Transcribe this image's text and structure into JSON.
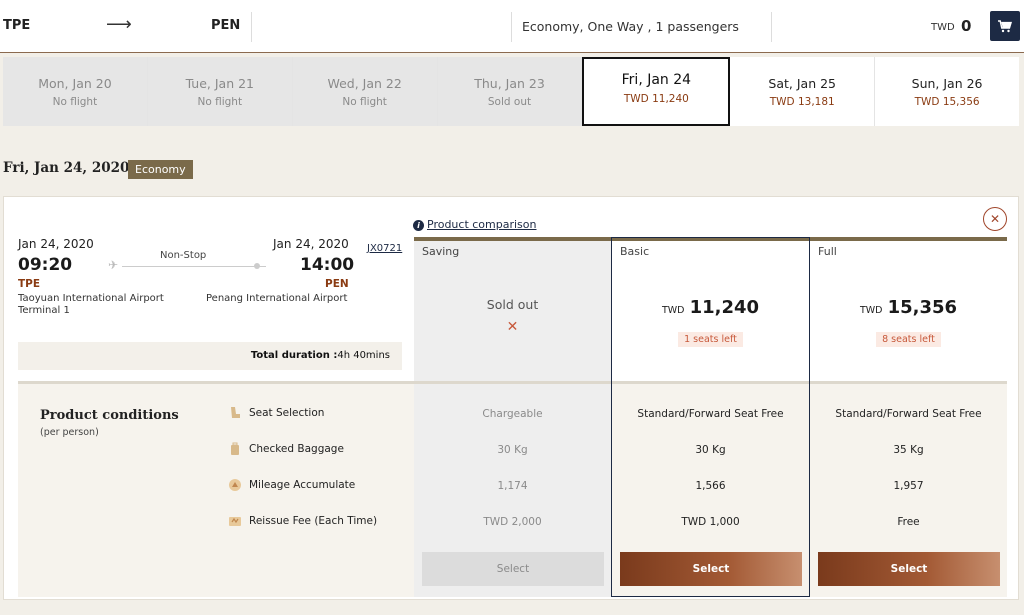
{
  "search": {
    "origin": "TPE",
    "destination": "PEN",
    "trip_summary": "Economy, One Way , 1 passengers",
    "currency": "TWD",
    "total": "0"
  },
  "dates": [
    {
      "name": "Mon, Jan 20",
      "sub": "No flight",
      "state": "disabled"
    },
    {
      "name": "Tue, Jan 21",
      "sub": "No flight",
      "state": "disabled"
    },
    {
      "name": "Wed, Jan 22",
      "sub": "No flight",
      "state": "disabled"
    },
    {
      "name": "Thu, Jan 23",
      "sub": "Sold out",
      "state": "disabled"
    },
    {
      "name": "Fri, Jan 24",
      "sub": "TWD 11,240",
      "state": "selected"
    },
    {
      "name": "Sat, Jan 25",
      "sub": "TWD 13,181",
      "state": "available"
    },
    {
      "name": "Sun, Jan 26",
      "sub": "TWD 15,356",
      "state": "available"
    }
  ],
  "selected_date_heading": "Fri, Jan 24, 2020",
  "cabin_badge": "Economy",
  "flight": {
    "dep_date": "Jan 24, 2020",
    "dep_time": "09:20",
    "dep_code": "TPE",
    "dep_airport": "Taoyuan International Airport",
    "dep_terminal": "Terminal 1",
    "arr_date": "Jan 24, 2020",
    "arr_time": "14:00",
    "arr_code": "PEN",
    "arr_airport": "Penang International Airport",
    "stops": "Non-Stop",
    "flight_number": "JX0721",
    "duration_label": "Total duration :",
    "duration_value": "4h 40mins"
  },
  "product_comparison_link": "Product comparison",
  "fares": {
    "saving": {
      "name": "Saving",
      "status": "Sold out",
      "select_label": "Select"
    },
    "basic": {
      "name": "Basic",
      "currency": "TWD",
      "price": "11,240",
      "seats_left": "1 seats left",
      "select_label": "Select"
    },
    "full": {
      "name": "Full",
      "currency": "TWD",
      "price": "15,356",
      "seats_left": "8 seats left",
      "select_label": "Select"
    }
  },
  "conditions": {
    "title": "Product conditions",
    "subtitle": "(per person)",
    "rows": [
      {
        "label": "Seat Selection",
        "icon": "seat-icon",
        "saving": "Chargeable",
        "basic": "Standard/Forward Seat Free",
        "full": "Standard/Forward Seat Free"
      },
      {
        "label": "Checked Baggage",
        "icon": "baggage-icon",
        "saving": "30 Kg",
        "basic": "30 Kg",
        "full": "35 Kg"
      },
      {
        "label": "Mileage Accumulate",
        "icon": "mileage-icon",
        "saving": "1,174",
        "basic": "1,566",
        "full": "1,957"
      },
      {
        "label": "Reissue Fee (Each Time)",
        "icon": "reissue-fee-icon",
        "saving": "TWD 2,000",
        "basic": "TWD 1,000",
        "full": "Free"
      }
    ]
  },
  "colors": {
    "navy": "#1d2a44",
    "brown_accent": "#8a3b12",
    "gold_bar": "#7a6a4a",
    "alert_red": "#c7593b"
  }
}
